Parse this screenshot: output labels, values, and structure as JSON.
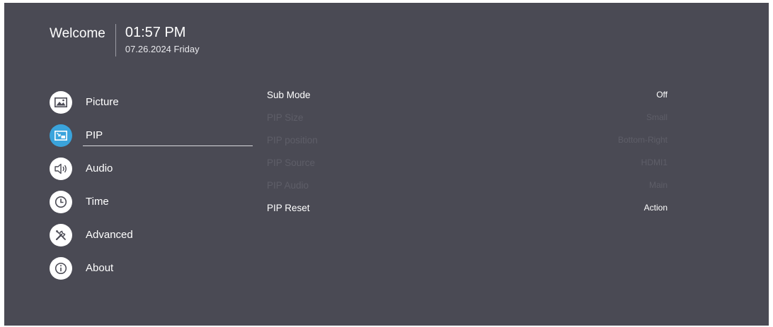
{
  "header": {
    "welcome": "Welcome",
    "time": "01:57 PM",
    "date": "07.26.2024 Friday"
  },
  "menu": {
    "items": [
      {
        "label": "Picture",
        "icon": "picture-icon"
      },
      {
        "label": "PIP",
        "icon": "pip-icon",
        "active": true
      },
      {
        "label": "Audio",
        "icon": "speaker-icon"
      },
      {
        "label": "Time",
        "icon": "clock-icon"
      },
      {
        "label": "Advanced",
        "icon": "tools-icon"
      },
      {
        "label": "About",
        "icon": "info-icon"
      }
    ]
  },
  "settings": {
    "rows": [
      {
        "label": "Sub Mode",
        "value": "Off",
        "enabled": true
      },
      {
        "label": "PIP Size",
        "value": "Small",
        "enabled": false
      },
      {
        "label": "PIP position",
        "value": "Bottom-Right",
        "enabled": false
      },
      {
        "label": "PIP Source",
        "value": "HDMI1",
        "enabled": false
      },
      {
        "label": "PIP Audio",
        "value": "Main",
        "enabled": false
      },
      {
        "label": "PIP Reset",
        "value": "Action",
        "enabled": true
      }
    ]
  },
  "colors": {
    "background": "#4a4a54",
    "accent": "#3aa4dc",
    "text": "#ffffff",
    "disabled_text": "#5e5e68"
  }
}
